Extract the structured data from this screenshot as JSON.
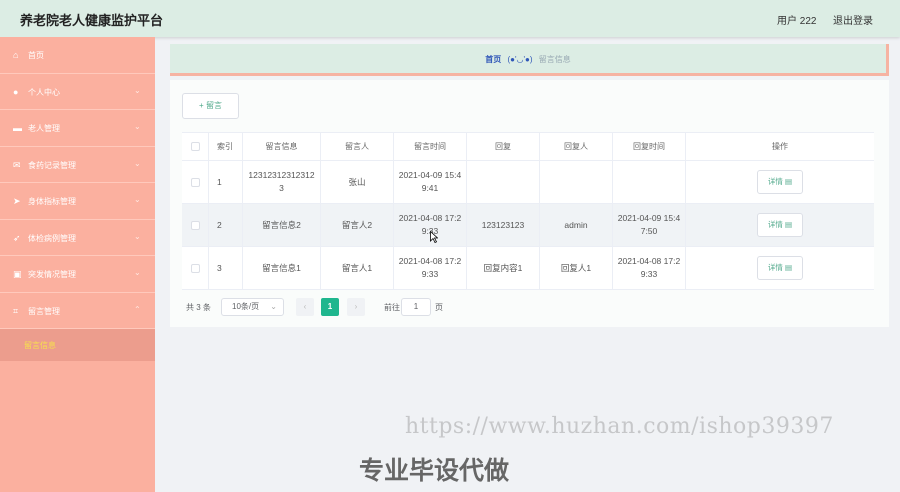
{
  "app": {
    "title": "养老院老人健康监护平台",
    "user": "用户 222",
    "logout": "退出登录"
  },
  "sidebar": {
    "items": [
      {
        "label": "首页",
        "icon": "home-icon",
        "glyph": "⌂",
        "arrow": ""
      },
      {
        "label": "个人中心",
        "icon": "user-icon",
        "glyph": "●",
        "arrow": "⌄"
      },
      {
        "label": "老人管理",
        "icon": "briefcase-icon",
        "glyph": "▬",
        "arrow": "⌄"
      },
      {
        "label": "食药记录管理",
        "icon": "mail-icon",
        "glyph": "✉",
        "arrow": "⌄"
      },
      {
        "label": "身体指标管理",
        "icon": "send-icon",
        "glyph": "➤",
        "arrow": "⌄"
      },
      {
        "label": "体检病例管理",
        "icon": "navigation-icon",
        "glyph": "➶",
        "arrow": "⌄"
      },
      {
        "label": "突发情况管理",
        "icon": "picture-icon",
        "glyph": "▣",
        "arrow": "⌄"
      },
      {
        "label": "留言管理",
        "icon": "crop-icon",
        "glyph": "⌗",
        "arrow": "⌃"
      }
    ],
    "submenu": {
      "label": "留言信息"
    }
  },
  "breadcrumb": {
    "home": "首页",
    "separator": "(●'◡'●)",
    "current": "留言信息"
  },
  "toolbar": {
    "add_label": "+ 留言"
  },
  "table": {
    "headers": [
      "索引",
      "留言信息",
      "留言人",
      "留言时间",
      "回复",
      "回复人",
      "回复时间",
      "操作"
    ],
    "rows": [
      {
        "index": "1",
        "message": "123123123123123",
        "author": "张山",
        "time": "2021-04-09 15:49:41",
        "reply": "",
        "replier": "",
        "reply_time": "",
        "action": "详情 ▤"
      },
      {
        "index": "2",
        "message": "留言信息2",
        "author": "留言人2",
        "time": "2021-04-08 17:29:33",
        "reply": "123123123",
        "replier": "admin",
        "reply_time": "2021-04-09 15:47:50",
        "action": "详情 ▤"
      },
      {
        "index": "3",
        "message": "留言信息1",
        "author": "留言人1",
        "time": "2021-04-08 17:29:33",
        "reply": "回复内容1",
        "replier": "回复人1",
        "reply_time": "2021-04-08 17:29:33",
        "action": "详情 ▤"
      }
    ]
  },
  "pagination": {
    "total": "共 3 条",
    "page_size": "10条/页",
    "prev": "‹",
    "current": "1",
    "next": "›",
    "goto": "前往",
    "goto_value": "1",
    "page_suffix": "页"
  },
  "overlay": {
    "watermark": "https://www.huzhan.com/ishop39397",
    "slogan": "专业毕设代做"
  },
  "colors": {
    "sidebar": "#fbb09f",
    "topbar": "#dcede4",
    "accent": "#1fb68e"
  }
}
